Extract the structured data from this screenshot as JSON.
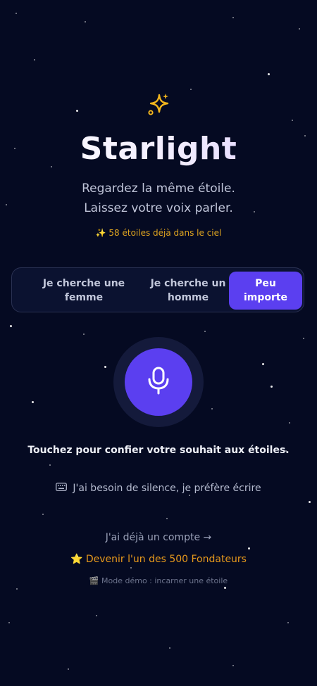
{
  "app": {
    "title": "Starlight",
    "subtitle_line1": "Regardez la même étoile.",
    "subtitle_line2": "Laissez votre voix parler.",
    "star_count": "✨ 58 étoiles déjà dans le ciel",
    "sparkle_icon": "sparkles-icon",
    "accent_color": "#5b3ff0",
    "gold_color": "#e0a520"
  },
  "preference": {
    "options": [
      {
        "label": "Je cherche une femme",
        "selected": false
      },
      {
        "label": "Je cherche un homme",
        "selected": false
      },
      {
        "label": "Peu importe",
        "selected": true
      }
    ]
  },
  "mic": {
    "icon": "microphone-icon",
    "instruction": "Touchez pour confier votre souhait aux étoiles."
  },
  "links": {
    "write": "J'ai besoin de silence, je préfère écrire",
    "write_icon": "keyboard-icon",
    "account": "J'ai déjà un compte →",
    "founders": "⭐ Devenir l'un des 500 Fondateurs",
    "demo": "🎬 Mode démo : incarner une étoile"
  }
}
